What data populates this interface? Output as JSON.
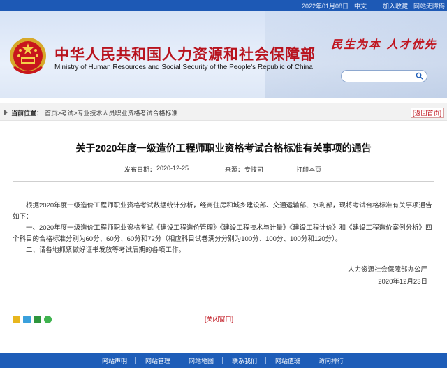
{
  "topbar": {
    "date": "2022年01月08日",
    "lang": "中文",
    "favorite": "加入收藏",
    "accessibility": "网站无障碍"
  },
  "header": {
    "site_name_cn": "中华人民共和国人力资源和社会保障部",
    "site_name_en": "Ministry of Human Resources and Social Security of the People's Republic of China",
    "slogan": "民生为本 人才优先",
    "search_placeholder": ""
  },
  "breadcrumb": {
    "label": "当前位置：",
    "path": "首页>考试>专业技术人员职业资格考试合格标准",
    "back_home": "[返回首页]"
  },
  "article": {
    "title": "关于2020年度一级造价工程师职业资格考试合格标准有关事项的通告",
    "publish_label": "发布日期：",
    "publish_date": "2020-12-25",
    "source_label": "来源：",
    "source": "专技司",
    "print": "打印本页",
    "paragraphs": [
      "根据2020年度一级造价工程师职业资格考试数据统计分析，经商住房和城乡建设部、交通运输部、水利部，现将考试合格标准有关事项通告如下：",
      "一、2020年度一级造价工程师职业资格考试《建设工程造价管理》《建设工程技术与计量》《建设工程计价》和《建设工程造价案例分析》四个科目的合格标准分别为60分、60分、60分和72分（相应科目试卷满分分别为100分、100分、100分和120分）。",
      "二、请各地抓紧做好证书发放等考试后期的各项工作。"
    ],
    "signature_org": "人力资源社会保障部办公厅",
    "signature_date": "2020年12月23日",
    "close_window": "[关闭窗口]"
  },
  "share_icons": [
    "weibo-share-icon",
    "qzone-share-icon",
    "douban-share-icon",
    "wechat-share-icon"
  ],
  "footer": {
    "links": [
      "网站声明",
      "网站管理",
      "网站地图",
      "联系我们",
      "网站值班",
      "访问排行"
    ]
  },
  "colors": {
    "brand_blue": "#1e5db8",
    "accent_red": "#c0151f"
  }
}
